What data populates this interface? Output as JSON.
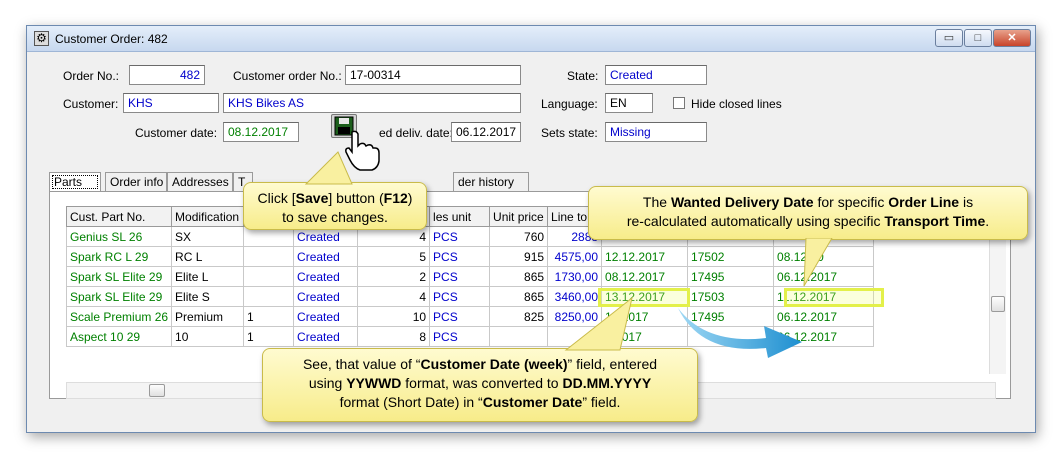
{
  "window": {
    "title": "Customer Order: 482",
    "buttons": {
      "minimize": "▭",
      "maximize": "□",
      "close": "✕"
    }
  },
  "form": {
    "order_no_label": "Order No.:",
    "order_no": "482",
    "customer_order_no_label": "Customer order No.:",
    "customer_order_no": "17-00314",
    "state_label": "State:",
    "state": "Created",
    "customer_label": "Customer:",
    "customer_code": "KHS",
    "customer_name": "KHS Bikes AS",
    "language_label": "Language:",
    "language": "EN",
    "hide_closed_label": "Hide closed lines",
    "customer_date_label": "Customer date:",
    "customer_date": "08.12.2017",
    "confirmed_deliv_label": "ed deliv. date:",
    "confirmed_deliv_date": "06.12.2017",
    "sets_state_label": "Sets state:",
    "sets_state": "Missing"
  },
  "tabs": [
    "Parts",
    "Order info",
    "Addresses",
    "T",
    "der history"
  ],
  "grid": {
    "headers": [
      "Cust. Part No.",
      "Modification",
      "",
      "",
      "",
      "les unit",
      "Unit price",
      "Line to",
      "",
      "",
      ""
    ],
    "rows": [
      [
        "Genius SL 26",
        "SX",
        "",
        "Created",
        "4",
        "PCS",
        "760",
        "2888",
        "",
        "",
        ""
      ],
      [
        "Spark RC L 29",
        "RC L",
        "",
        "Created",
        "5",
        "PCS",
        "915",
        "4575,00",
        "12.12.2017",
        "17502",
        "08.12.20"
      ],
      [
        "Spark SL Elite 29",
        "Elite L",
        "",
        "Created",
        "2",
        "PCS",
        "865",
        "1730,00",
        "08.12.2017",
        "17495",
        "06.12.2017"
      ],
      [
        "Spark SL Elite 29",
        "Elite S",
        "",
        "Created",
        "4",
        "PCS",
        "865",
        "3460,00",
        "13.12.2017",
        "17503",
        "11.12.2017"
      ],
      [
        "Scale Premium 26",
        "Premium",
        "1",
        "Created",
        "10",
        "PCS",
        "825",
        "8250,00",
        "12.2017",
        "17495",
        "06.12.2017"
      ],
      [
        "Aspect 10 29",
        "10",
        "1",
        "Created",
        "8",
        "PCS",
        "",
        "",
        "2.2017",
        "",
        "06.12.2017"
      ]
    ]
  },
  "callouts": {
    "save_pre": "Click [",
    "save_bold": "Save",
    "save_mid": "] button (",
    "save_key": "F12",
    "save_post": ")",
    "save_line2": "to save changes.",
    "wanted_1": "The ",
    "wanted_b1": "Wanted Delivery Date",
    "wanted_2": " for specific ",
    "wanted_b2": "Order Line",
    "wanted_3": " is",
    "wanted_4": "re-calculated automatically using specific ",
    "wanted_b3": "Transport Time",
    "wanted_5": ".",
    "see_1": "See, that value of “",
    "see_b1": "Customer Date (week)",
    "see_2": "” field, entered",
    "see_3": "using ",
    "see_b2": "YYWWD",
    "see_4": " format, was converted to ",
    "see_b3": "DD.MM.YYYY",
    "see_5": "format (Short Date) in “",
    "see_b4": "Customer Date",
    "see_6": "” field."
  }
}
